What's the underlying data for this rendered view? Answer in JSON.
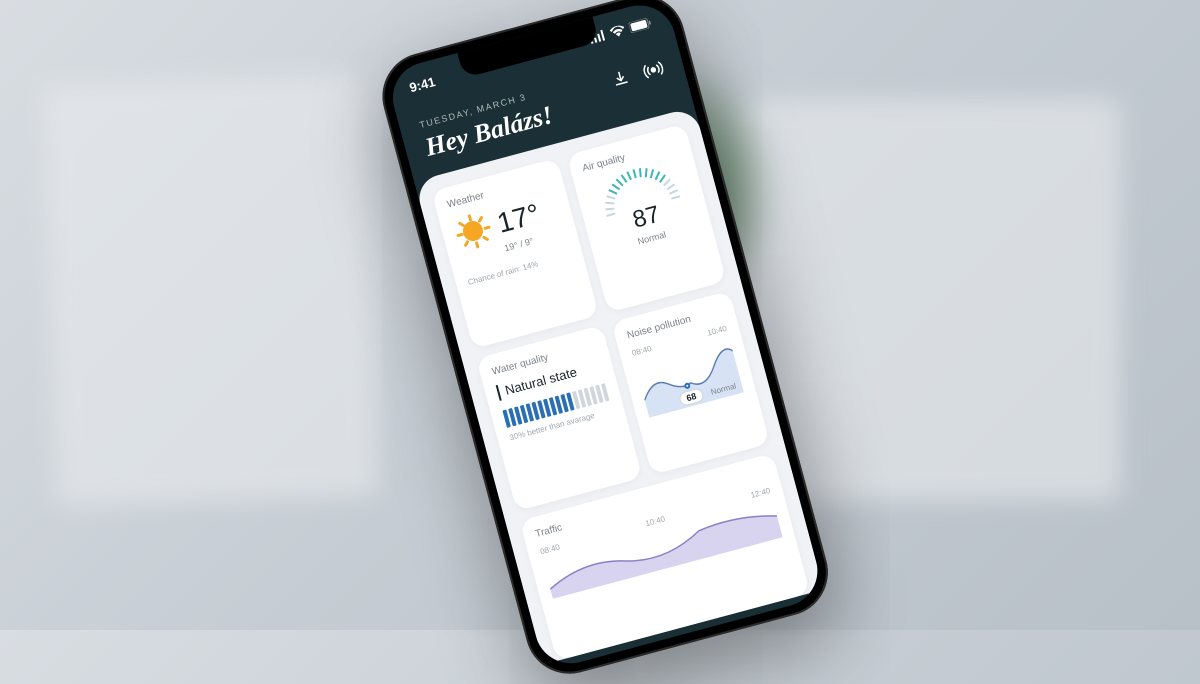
{
  "status": {
    "time": "9:41"
  },
  "header": {
    "date_label": "TUESDAY, MARCH 3",
    "greeting": "Hey Balázs!"
  },
  "weather": {
    "title": "Weather",
    "temp": "17°",
    "range": "19° / 9°",
    "rain": "Chance of rain: 14%"
  },
  "aqi": {
    "title": "Air quality",
    "value": "87",
    "state": "Normal"
  },
  "water": {
    "title": "Water quality",
    "label": "Natural state",
    "sub": "30% better than avarage"
  },
  "noise": {
    "title": "Noise pollution",
    "t1": "08:40",
    "t2": "10:40",
    "value": "68",
    "state": "Normal"
  },
  "traffic": {
    "title": "Traffic",
    "t1": "08:40",
    "t2": "10:40",
    "t3": "12:40"
  }
}
